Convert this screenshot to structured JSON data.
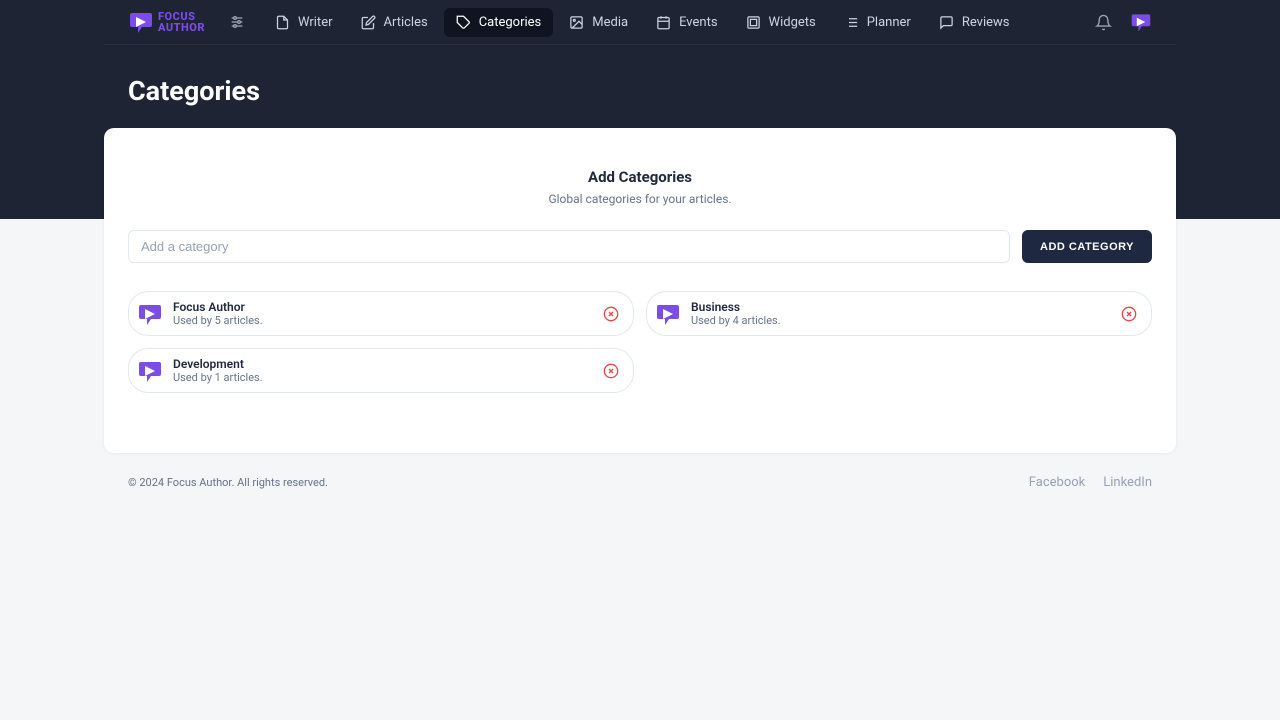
{
  "brand": {
    "line1": "FOCUS",
    "line2": "AUTHOR"
  },
  "nav": {
    "items": [
      {
        "label": "Writer",
        "icon": "file"
      },
      {
        "label": "Articles",
        "icon": "edit"
      },
      {
        "label": "Categories",
        "icon": "tag",
        "active": true
      },
      {
        "label": "Media",
        "icon": "image"
      },
      {
        "label": "Events",
        "icon": "calendar"
      },
      {
        "label": "Widgets",
        "icon": "layout"
      },
      {
        "label": "Planner",
        "icon": "list"
      },
      {
        "label": "Reviews",
        "icon": "message"
      }
    ]
  },
  "page": {
    "title": "Categories"
  },
  "card": {
    "title": "Add Categories",
    "subtitle": "Global categories for your articles.",
    "input_placeholder": "Add a category",
    "add_button": "ADD CATEGORY"
  },
  "categories": [
    {
      "name": "Focus Author",
      "meta": "Used by 5 articles."
    },
    {
      "name": "Business",
      "meta": "Used by 4 articles."
    },
    {
      "name": "Development",
      "meta": "Used by 1 articles."
    }
  ],
  "footer": {
    "copyright": "© 2024 Focus Author. All rights reserved.",
    "links": [
      {
        "label": "Facebook"
      },
      {
        "label": "LinkedIn"
      }
    ]
  }
}
